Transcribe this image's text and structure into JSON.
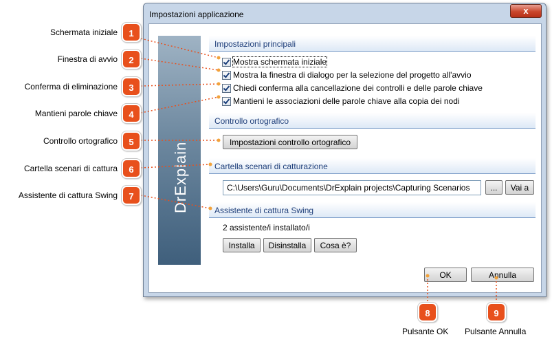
{
  "window": {
    "title": "Impostazioni applicazione",
    "close_glyph": "x"
  },
  "sidebar": {
    "logo_text": "DrExplain"
  },
  "sections": {
    "main": "Impostazioni principali",
    "spell": "Controllo ortografico",
    "capture": "Cartella scenari di catturazione",
    "swing": "Assistente di cattura Swing"
  },
  "checkboxes": [
    {
      "label": "Mostra schermata iniziale",
      "checked": true
    },
    {
      "label": "Mostra la finestra di dialogo per la selezione del progetto all'avvio",
      "checked": true
    },
    {
      "label": "Chiedi conferma alla cancellazione dei controlli e delle parole chiave",
      "checked": true
    },
    {
      "label": "Mantieni le associazioni delle parole chiave alla copia dei nodi",
      "checked": true
    }
  ],
  "buttons": {
    "spell_settings": "Impostazioni controllo ortografico",
    "browse": "...",
    "goto": "Vai a",
    "install": "Installa",
    "uninstall": "Disinstalla",
    "what": "Cosa è?",
    "ok": "OK",
    "cancel": "Annulla"
  },
  "capture_path": "C:\\Users\\Guru\\Documents\\DrExplain projects\\Capturing Scenarios",
  "swing_status": "2 assistente/i installato/i",
  "callouts": [
    {
      "num": "1",
      "label": "Schermata iniziale"
    },
    {
      "num": "2",
      "label": "Finestra di avvio"
    },
    {
      "num": "3",
      "label": "Conferma di eliminazione"
    },
    {
      "num": "4",
      "label": "Mantieni parole chiave"
    },
    {
      "num": "5",
      "label": "Controllo ortografico"
    },
    {
      "num": "6",
      "label": "Cartella scenari di cattura"
    },
    {
      "num": "7",
      "label": "Assistente di cattura Swing"
    },
    {
      "num": "8",
      "label": "Pulsante OK"
    },
    {
      "num": "9",
      "label": "Pulsante Annulla"
    }
  ],
  "colors": {
    "badge": "#e8501c",
    "leader": "#e8501c",
    "section_text": "#1f3f7a"
  }
}
